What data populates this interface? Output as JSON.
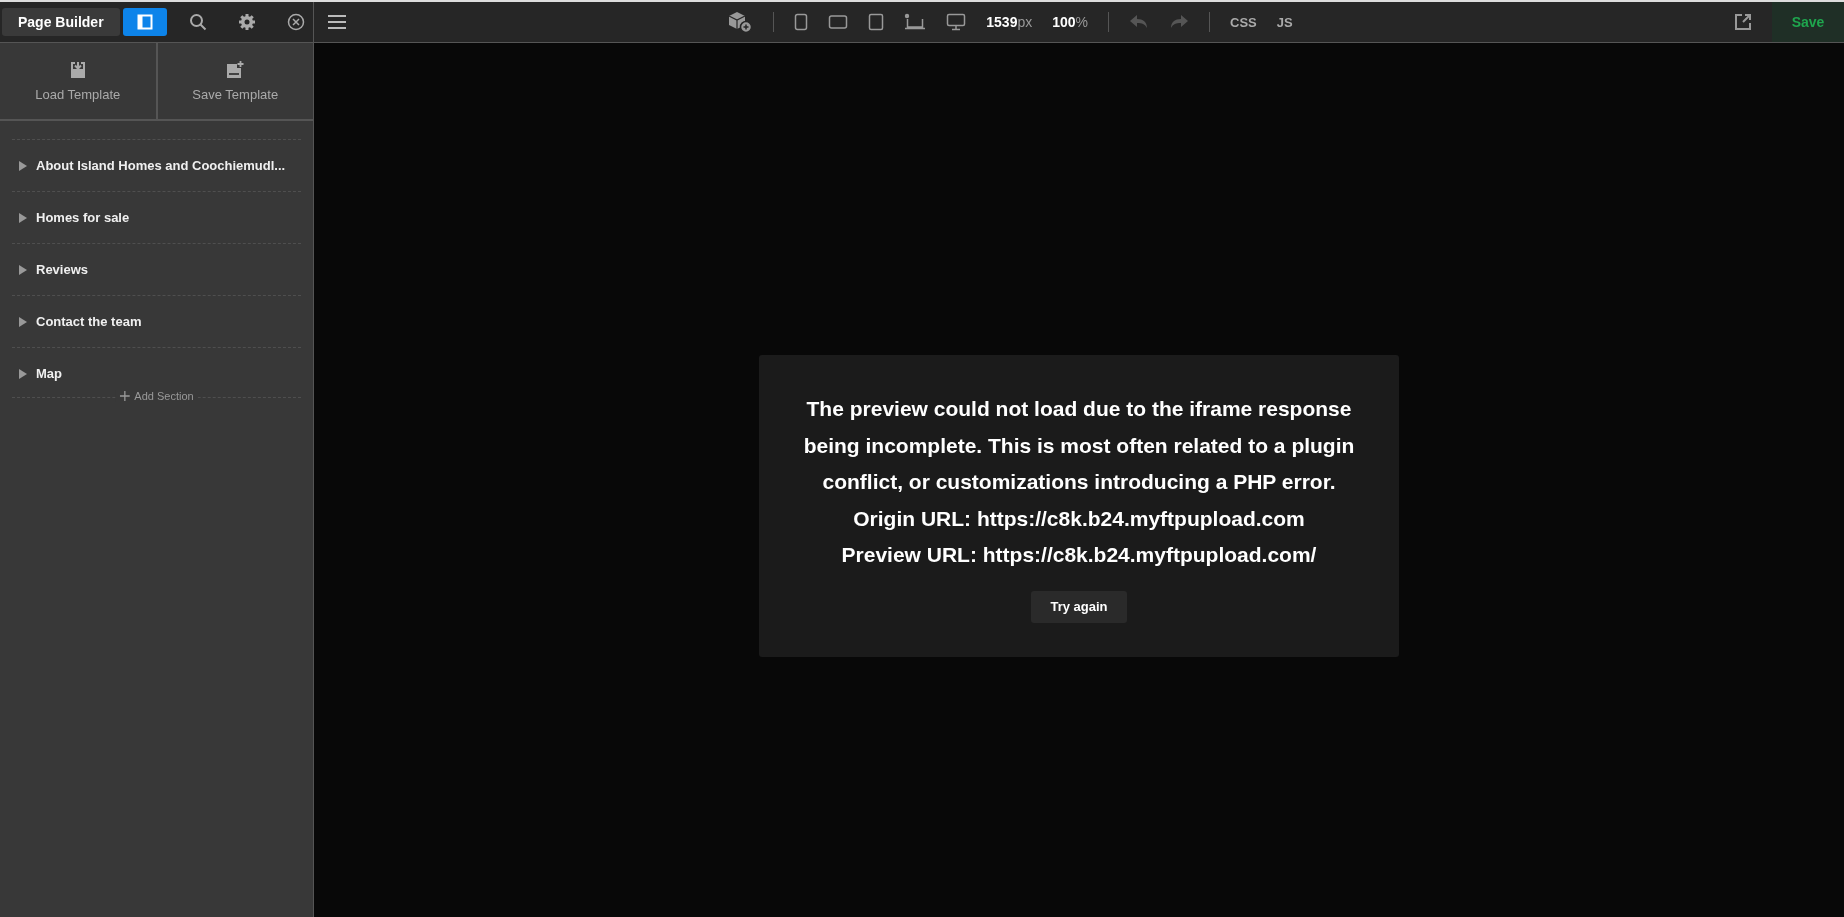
{
  "toolbar": {
    "title": "Page Builder",
    "width": {
      "value": "1539",
      "unit": "px"
    },
    "zoom": {
      "value": "100",
      "unit": "%"
    },
    "code_tabs": [
      "CSS",
      "JS"
    ],
    "save": "Save"
  },
  "templates": [
    "Load Template",
    "Save Template"
  ],
  "sections": [
    {
      "title": "About Island Homes and Coochiemudl...",
      "expanded": false
    },
    {
      "title": "Homes for sale",
      "expanded": false
    },
    {
      "title": "Reviews",
      "expanded": false
    },
    {
      "title": "Contact the team",
      "expanded": false
    },
    {
      "title": "Map",
      "expanded": false
    }
  ],
  "add_section": "Add Section",
  "preview_error": {
    "lines": [
      "The preview could not load due to the iframe response being incomplete. This is most often related to a plugin conflict, or customizations introducing a PHP error.",
      "Origin URL: https://c8k.b24.myftpupload.com",
      "Preview URL: https://c8k.b24.myftpupload.com/"
    ],
    "button": "Try again"
  }
}
